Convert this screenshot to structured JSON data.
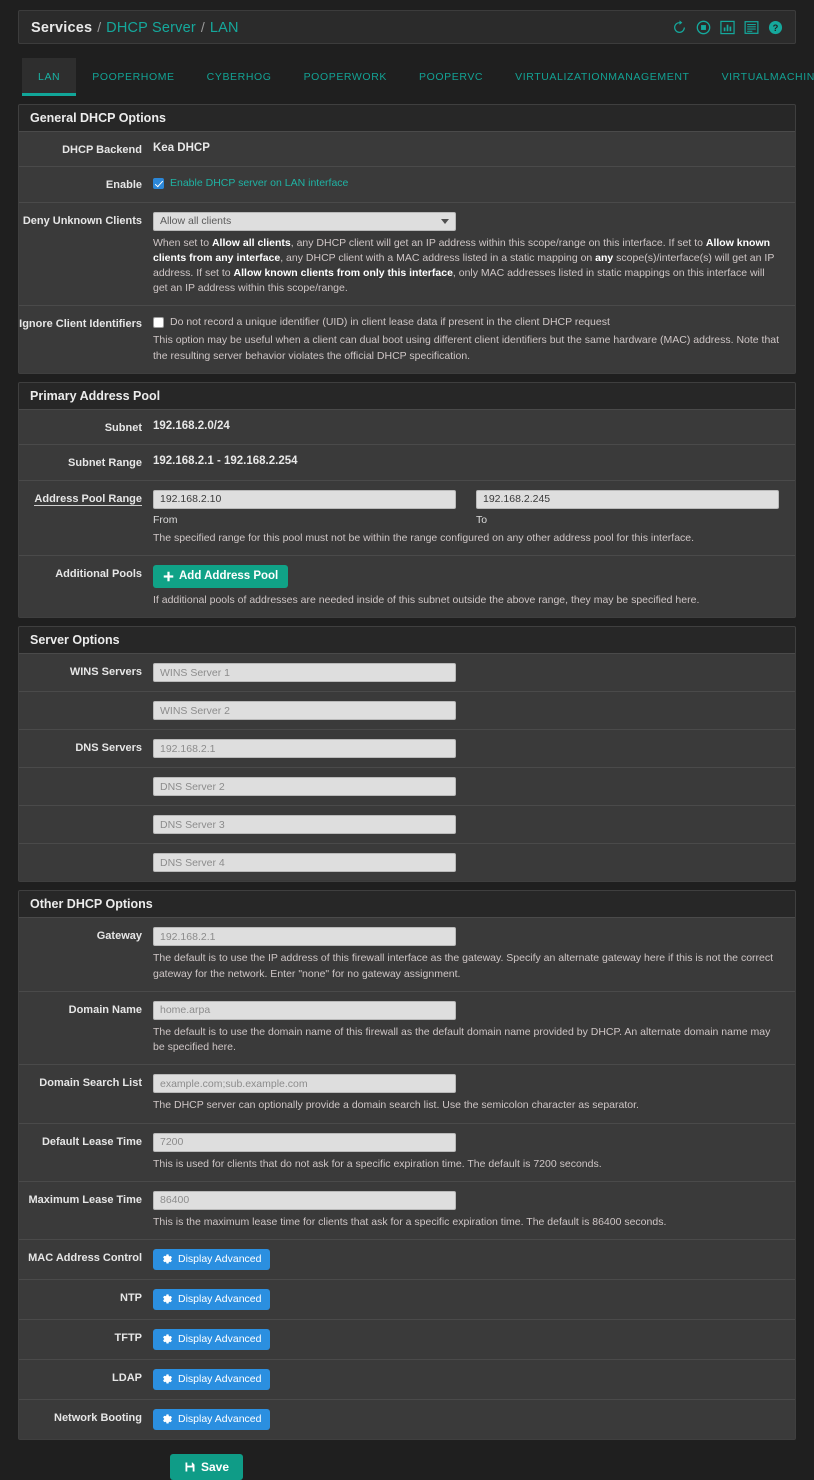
{
  "breadcrumb": {
    "root": "Services",
    "sep": "/",
    "section": "DHCP Server",
    "current": "LAN",
    "icons": [
      "restart-service-icon",
      "stop-service-icon",
      "status-chart-icon",
      "log-icon",
      "help-icon"
    ]
  },
  "tabs": [
    {
      "label": "LAN",
      "active": true
    },
    {
      "label": "POOPERHOME",
      "active": false
    },
    {
      "label": "CYBERHOG",
      "active": false
    },
    {
      "label": "POOPERWORK",
      "active": false
    },
    {
      "label": "POOPERVC",
      "active": false
    },
    {
      "label": "VIRTUALIZATIONMANAGEMENT",
      "active": false
    },
    {
      "label": "VIRTUALMACHINES",
      "active": false
    }
  ],
  "general": {
    "title": "General DHCP Options",
    "backend_label": "DHCP Backend",
    "backend_value": "Kea DHCP",
    "enable_label": "Enable",
    "enable_checkbox_label": "Enable DHCP server on LAN interface",
    "enable_checked": true,
    "deny_label": "Deny Unknown Clients",
    "deny_selected": "Allow all clients",
    "deny_options": [
      "Allow all clients",
      "Allow known clients from any interface",
      "Allow known clients from only this interface"
    ],
    "deny_help_1": "When set to ",
    "deny_help_b1": "Allow all clients",
    "deny_help_2": ", any DHCP client will get an IP address within this scope/range on this interface. If set to ",
    "deny_help_b2": "Allow known clients from any interface",
    "deny_help_3": ", any DHCP client with a MAC address listed in a static mapping on ",
    "deny_help_b3": "any",
    "deny_help_4": " scope(s)/interface(s) will get an IP address. If set to ",
    "deny_help_b4": "Allow known clients from only this interface",
    "deny_help_5": ", only MAC addresses listed in static mappings on this interface will get an IP address within this scope/range.",
    "ignore_label": "Ignore Client Identifiers",
    "ignore_checkbox_label": "Do not record a unique identifier (UID) in client lease data if present in the client DHCP request",
    "ignore_checked": false,
    "ignore_help": "This option may be useful when a client can dual boot using different client identifiers but the same hardware (MAC) address. Note that the resulting server behavior violates the official DHCP specification."
  },
  "primary_pool": {
    "title": "Primary Address Pool",
    "subnet_label": "Subnet",
    "subnet_value": "192.168.2.0/24",
    "subnet_range_label": "Subnet Range",
    "subnet_range_value": "192.168.2.1 - 192.168.2.254",
    "pool_range_label": "Address Pool Range",
    "from_value": "192.168.2.10",
    "from_sublabel": "From",
    "to_value": "192.168.2.245",
    "to_sublabel": "To",
    "pool_range_help": "The specified range for this pool must not be within the range configured on any other address pool for this interface.",
    "additional_label": "Additional Pools",
    "add_pool_button": "Add Address Pool",
    "add_pool_icon": "plus-icon",
    "additional_help": "If additional pools of addresses are needed inside of this subnet outside the above range, they may be specified here."
  },
  "server_options": {
    "title": "Server Options",
    "wins_label": "WINS Servers",
    "wins": [
      {
        "placeholder": "WINS Server 1",
        "value": ""
      },
      {
        "placeholder": "WINS Server 2",
        "value": ""
      }
    ],
    "dns_label": "DNS Servers",
    "dns": [
      {
        "placeholder": "192.168.2.1",
        "value": ""
      },
      {
        "placeholder": "DNS Server 2",
        "value": ""
      },
      {
        "placeholder": "DNS Server 3",
        "value": ""
      },
      {
        "placeholder": "DNS Server 4",
        "value": ""
      }
    ]
  },
  "other_options": {
    "title": "Other DHCP Options",
    "gateway_label": "Gateway",
    "gateway_placeholder": "192.168.2.1",
    "gateway_help": "The default is to use the IP address of this firewall interface as the gateway. Specify an alternate gateway here if this is not the correct gateway for the network. Enter \"none\" for no gateway assignment.",
    "domain_label": "Domain Name",
    "domain_placeholder": "home.arpa",
    "domain_help": "The default is to use the domain name of this firewall as the default domain name provided by DHCP. An alternate domain name may be specified here.",
    "search_label": "Domain Search List",
    "search_placeholder": "example.com;sub.example.com",
    "search_help": "The DHCP server can optionally provide a domain search list. Use the semicolon character as separator.",
    "default_lease_label": "Default Lease Time",
    "default_lease_placeholder": "7200",
    "default_lease_help": "This is used for clients that do not ask for a specific expiration time. The default is 7200 seconds.",
    "max_lease_label": "Maximum Lease Time",
    "max_lease_placeholder": "86400",
    "max_lease_help": "This is the maximum lease time for clients that ask for a specific expiration time. The default is 86400 seconds.",
    "advanced_button_label": "Display Advanced",
    "advanced_icon": "gear-icon",
    "advanced_rows": [
      {
        "label": "MAC Address Control"
      },
      {
        "label": "NTP"
      },
      {
        "label": "TFTP"
      },
      {
        "label": "LDAP"
      },
      {
        "label": "Network Booting"
      }
    ]
  },
  "footer": {
    "save_label": "Save",
    "save_icon": "save-icon"
  },
  "colors": {
    "accent_teal": "#11a699",
    "button_green": "#10a287",
    "button_blue": "#2b8fe0",
    "panel_bg": "#3a3a3a",
    "page_bg": "#1f1f1f"
  }
}
